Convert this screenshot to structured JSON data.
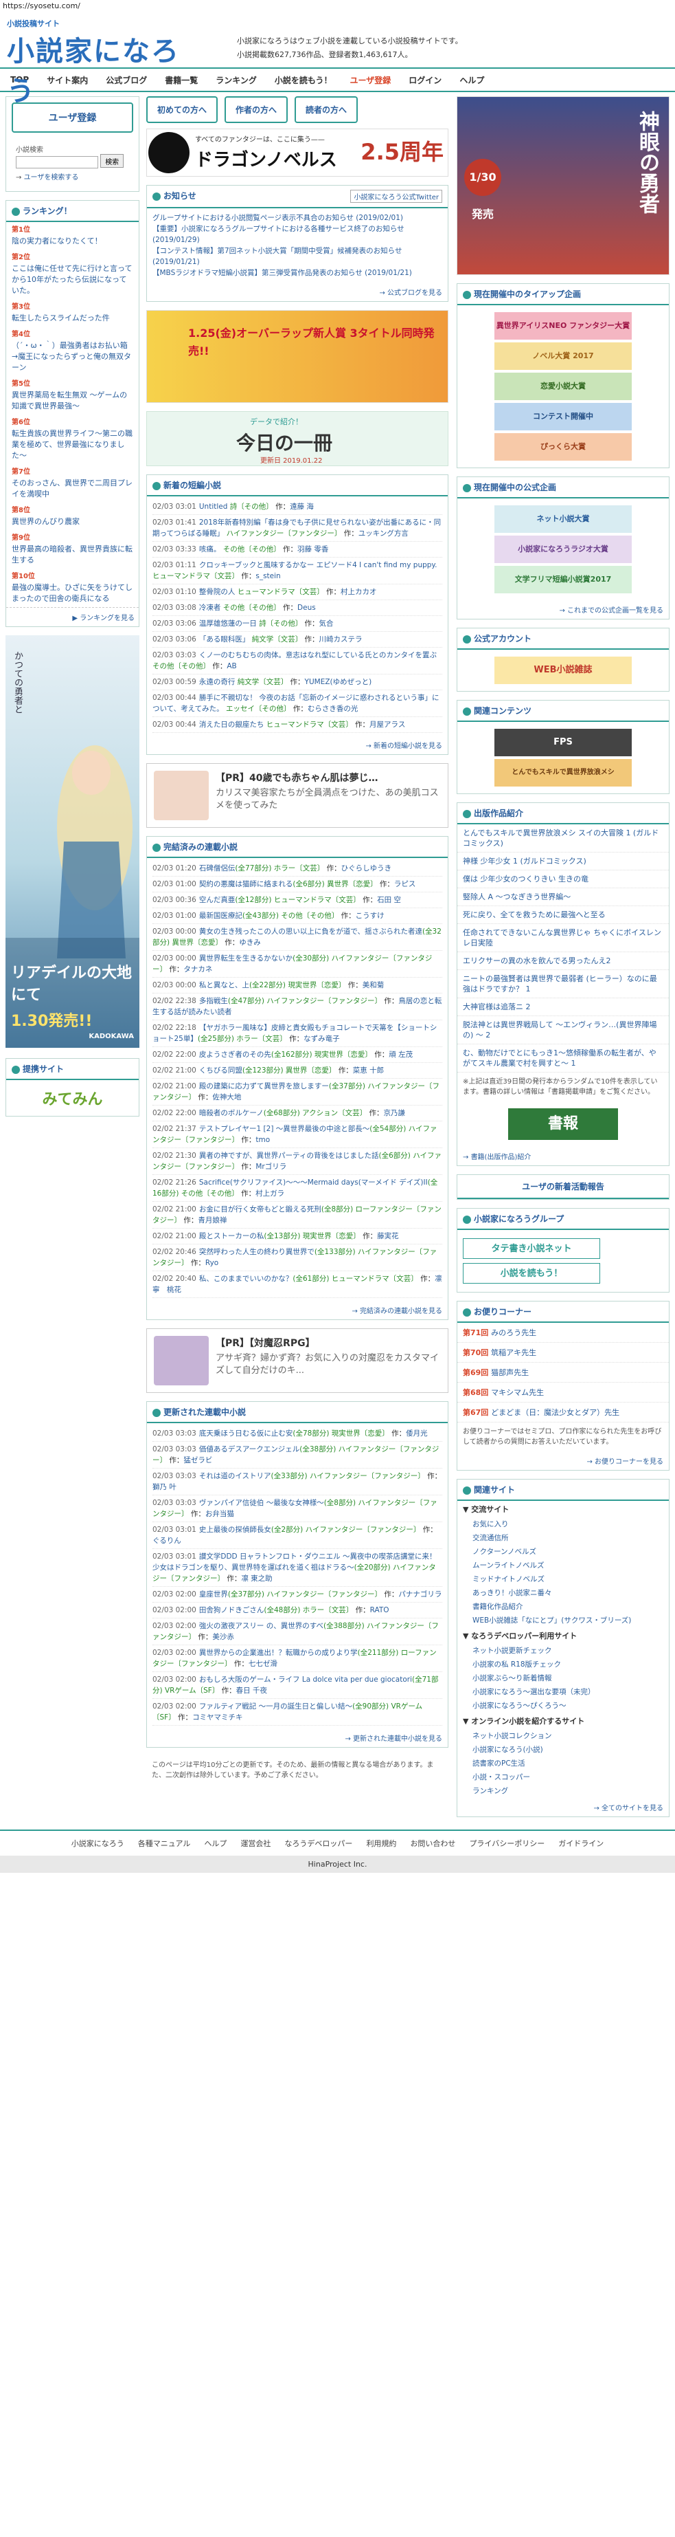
{
  "url": "https://syosetu.com/",
  "header": {
    "logo_small": "小説投稿サイト",
    "logo_big": "小説家になろう",
    "desc1": "小説家になろうはウェブ小説を連載している小説投稿サイトです。",
    "desc2": "小説掲載数627,736作品、登録者数1,463,617人。"
  },
  "nav": [
    {
      "label": "TOP"
    },
    {
      "label": "サイト案内"
    },
    {
      "label": "公式ブログ"
    },
    {
      "label": "書籍一覧"
    },
    {
      "label": "ランキング"
    },
    {
      "label": "小説を読もう！"
    },
    {
      "label": "ユーザ登録"
    },
    {
      "label": "ログイン"
    },
    {
      "label": "ヘルプ"
    }
  ],
  "left": {
    "login_button": "ユーザ登録",
    "search_label": "小説検索",
    "search_button": "検索",
    "user_search": "ユーザを検索する",
    "ranking_title": "ランキング！",
    "ranking": [
      {
        "no": "第1位",
        "title": "陰の実力者になりたくて！"
      },
      {
        "no": "第2位",
        "title": "ここは俺に任せて先に行けと言ってから10年がたったら伝説になっていた。"
      },
      {
        "no": "第3位",
        "title": "転生したらスライムだった件"
      },
      {
        "no": "第4位",
        "title": "（´・ω・｀）最強勇者はお払い箱→魔王になったらずっと俺の無双ターン"
      },
      {
        "no": "第5位",
        "title": "異世界薬局を転生無双 〜ゲームの知識で異世界最強〜"
      },
      {
        "no": "第6位",
        "title": "転生貴族の異世界ライフ〜第二の職業を極めて、世界最強になりました〜"
      },
      {
        "no": "第7位",
        "title": "そのおっさん、異世界で二周目プレイを満喫中"
      },
      {
        "no": "第8位",
        "title": "異世界のんびり農家"
      },
      {
        "no": "第9位",
        "title": "世界最高の暗殺者、異世界貴族に転生する"
      },
      {
        "no": "第10位",
        "title": "最強の魔導士。ひざに矢をうけてしまったので田舎の衛兵になる"
      }
    ],
    "ranking_more": "ランキングを見る",
    "banner_text1": "かつての勇者と",
    "banner_title": "リアデイルの大地にて",
    "banner_release": "1.30発売!!",
    "banner_pub": "KADOKAWA",
    "sites_title": "提携サイト",
    "sites_logo": "みてみん"
  },
  "main": {
    "tabs": [
      {
        "label": "初めての方へ"
      },
      {
        "label": "作者の方へ"
      },
      {
        "label": "読者の方へ"
      }
    ],
    "banner_top_text": "すべてのファンタジーは、ここに集う——",
    "banner_top_brand": "ドラゴンノベルス",
    "banner_top_num": "2.5周年",
    "notice_title": "お知らせ",
    "notice_twitter": "小説家になろう公式Twitter",
    "notices": [
      {
        "text": "グループサイトにおける小説閲覧ページ表示不具合のお知らせ (2019/02/01)"
      },
      {
        "text": "【重要】小説家になろうグループサイトにおける各種サービス終了のお知らせ (2019/01/29)"
      },
      {
        "text": "【コンテスト情報】第7回ネット小説大賞「期間中受賞」候補発表のお知らせ (2019/01/21)"
      },
      {
        "text": "【MBSラジオドラマ短編小説賞】第三弾受賞作品発表のお知らせ (2019/01/21)"
      }
    ],
    "notice_more": "公式ブログを見る",
    "banner_mid_text": "1.25(金)オーバーラップ新人賞 3タイトル同時発売!!",
    "book_label": "データで紹介！",
    "book_title": "今日の一冊",
    "book_date": "更新日 2019.01.22",
    "new_short_title": "新着の短編小説",
    "new_short": [
      {
        "date": "02/03 03:01",
        "title": "Untitled",
        "genre": "詩〔その他〕",
        "author": "遠藤 海"
      },
      {
        "date": "02/03 01:41",
        "title": "2018年新春特別編「春は身でも子供に見せられない姿が出番にあるに・同期ってつらばる睡眠」",
        "genre": "ハイファンタジー〔ファンタジー〕",
        "author": "ユッキング方言"
      },
      {
        "date": "02/03 03:33",
        "title": "咳痛。",
        "genre": "その他〔その他〕",
        "author": "羽藤 零香"
      },
      {
        "date": "02/03 01:11",
        "title": "クロッキーブックと風味するかなー エピソード4 I can't find my puppy.",
        "genre": "ヒューマンドラマ〔文芸〕",
        "author": "s_stein"
      },
      {
        "date": "02/03 01:10",
        "title": "整骨院の人",
        "genre": "ヒューマンドラマ〔文芸〕",
        "author": "村上カカオ"
      },
      {
        "date": "02/03 03:08",
        "title": "冷凍者",
        "genre": "その他〔その他〕",
        "author": "Deus"
      },
      {
        "date": "02/03 03:06",
        "title": "温厚雄悠蓮の一日",
        "genre": "詩〔その他〕",
        "author": "気合"
      },
      {
        "date": "02/03 03:06",
        "title": "「ある眼科医」",
        "genre": "純文学〔文芸〕",
        "author": "川崎カステラ"
      },
      {
        "date": "02/03 03:03",
        "title": "くノ一のむちむちの肉体。意志はなれ型にしている氏とのカンタイを置ぶ",
        "genre": "その他〔その他〕",
        "author": "AB"
      },
      {
        "date": "02/03 00:59",
        "title": "永遠の奇行",
        "genre": "純文学〔文芸〕",
        "author": "YUMEZ(ゆめぜっと)"
      },
      {
        "date": "02/03 00:44",
        "title": "勝手に不親切な！ 今夜のお話「忘新のイメージに惑わされるという事」について、考えてみた。",
        "genre": "エッセイ〔その他〕",
        "author": "むらさき香の光"
      },
      {
        "date": "02/03 00:44",
        "title": "消えた日の銀座たち",
        "genre": "ヒューマンドラマ〔文芸〕",
        "author": "月屋アラス"
      }
    ],
    "new_short_more": "新着の短編小説を見る",
    "pr1_head": "【PR】40歳でも赤ちゃん肌は夢じ…",
    "pr1_desc": "カリスマ美容家たちが全員満点をつけた、あの美肌コスメを使ってみた",
    "finished_title": "完結済みの連載小説",
    "finished": [
      {
        "date": "02/03 01:20",
        "title": "石碑僧侶伝",
        "parts": "(全77部分)",
        "genre": "ホラー〔文芸〕",
        "author": "ひぐらしゆうき"
      },
      {
        "date": "02/03 01:00",
        "title": "契約の悪魔は猫師に絡まれる",
        "parts": "(全6部分)",
        "genre": "異世界〔恋愛〕",
        "author": "ラピス"
      },
      {
        "date": "02/03 00:36",
        "title": "空んだ真亜",
        "parts": "(全12部分)",
        "genre": "ヒューマンドラマ〔文芸〕",
        "author": "石田 空"
      },
      {
        "date": "02/03 01:00",
        "title": "最新国医療記",
        "parts": "(全43部分)",
        "genre": "その他〔その他〕",
        "author": "こうすけ"
      },
      {
        "date": "02/03 00:00",
        "title": "黄女の生き残ったこの人の思い以上に負をが道で、揺さぶられた者達",
        "parts": "(全32部分)",
        "genre": "異世界〔恋愛〕",
        "author": "ゆきみ"
      },
      {
        "date": "02/03 00:00",
        "title": "異世界転生を生きるかないか",
        "parts": "(全30部分)",
        "genre": "ハイファンタジー〔ファンタジー〕",
        "author": "タナカネ"
      },
      {
        "date": "02/03 00:00",
        "title": "私と異なと、上",
        "parts": "(全22部分)",
        "genre": "現実世界〔恋愛〕",
        "author": "美和菊"
      },
      {
        "date": "02/02 22:38",
        "title": "多指戦生",
        "parts": "(全47部分)",
        "genre": "ハイファンタジー〔ファンタジー〕",
        "author": "鳥居の恋と転生する話が読みたい読者"
      },
      {
        "date": "02/02 22:18",
        "title": "【ヤガホラー風味な】皮締と貴女殿もチョコレートで天箒を【ショートショート25単】",
        "parts": "(全25部分)",
        "genre": "ホラー〔文芸〕",
        "author": "なずみ竜子"
      },
      {
        "date": "02/02 22:00",
        "title": "皮ようさぎ者のその先",
        "parts": "(全162部分)",
        "genre": "現実世界〔恋愛〕",
        "author": "頑 左茂"
      },
      {
        "date": "02/02 21:00",
        "title": "くちびる同盟",
        "parts": "(全123部分)",
        "genre": "異世界〔恋愛〕",
        "author": "菜恵 十郎"
      },
      {
        "date": "02/02 21:00",
        "title": "殿の建築に応力ずて異世界を旅しますー",
        "parts": "(全37部分)",
        "genre": "ハイファンタジー〔ファンタジー〕",
        "author": "佐神大地"
      },
      {
        "date": "02/02 22:00",
        "title": "暗殺者のボルケーノ",
        "parts": "(全68部分)",
        "genre": "アクション〔文芸〕",
        "author": "京乃謙"
      },
      {
        "date": "02/02 21:37",
        "title": "テストプレイヤー1 [2] 〜異世界最後の中途と部長〜",
        "parts": "(全54部分)",
        "genre": "ハイファンタジー〔ファンタジー〕",
        "author": "tmo"
      },
      {
        "date": "02/02 21:30",
        "title": "異者の神ですが、異世界パーティの背後をはじました話",
        "parts": "(全6部分)",
        "genre": "ハイファンタジー〔ファンタジー〕",
        "author": "Mrゴリラ"
      },
      {
        "date": "02/02 21:26",
        "title": "Sacrifice(サクリファイス)〜〜〜Mermaid days(マーメイド デイズ)II",
        "parts": "(全16部分)",
        "genre": "その他〔その他〕",
        "author": "村上ガラ"
      },
      {
        "date": "02/02 21:00",
        "title": "お金に目が行く女帝もどと鍛える死刑",
        "parts": "(全8部分)",
        "genre": "ローファンタジー〔ファンタジー〕",
        "author": "青月娘禅"
      },
      {
        "date": "02/02 21:00",
        "title": "殿とストーカーの私",
        "parts": "(全13部分)",
        "genre": "現実世界〔恋愛〕",
        "author": "藤実花"
      },
      {
        "date": "02/02 20:46",
        "title": "突然呼わった人生の終わり異世界で",
        "parts": "(全133部分)",
        "genre": "ハイファンタジー〔ファンタジー〕",
        "author": "Ryo"
      },
      {
        "date": "02/02 20:40",
        "title": "私、このままでいいのかな？",
        "parts": "(全61部分)",
        "genre": "ヒューマンドラマ〔文芸〕",
        "author": "凛寧　桃花"
      }
    ],
    "finished_more": "完結済みの連載小説を見る",
    "pr2_head": "【PR】【対魔忍RPG】",
    "pr2_desc": "アサギ斉？婦かず斉？お気に入りの対魔忍をカスタマイズして自分だけのキ...",
    "updated_title": "更新された連載中小説",
    "updated": [
      {
        "date": "02/03 03:03",
        "title": "底天乗ほう日むる仮に止む安",
        "parts": "(全78部分)",
        "genre": "現実世界〔恋愛〕",
        "author": "倭月光"
      },
      {
        "date": "02/03 03:03",
        "title": "価値あるデスアークエンジェル",
        "parts": "(全38部分)",
        "genre": "ハイファンタジー〔ファンタジー〕",
        "author": "猛ゼラビ"
      },
      {
        "date": "02/03 03:03",
        "title": "それは道のイストリア",
        "parts": "(全33部分)",
        "genre": "ハイファンタジー〔ファンタジー〕",
        "author": "獅乃 叶"
      },
      {
        "date": "02/03 03:03",
        "title": "ヴァンパイア信徒伯 〜最後な女神様〜",
        "parts": "(全8部分)",
        "genre": "ハイファンタジー〔ファンタジー〕",
        "author": "お弁当猫"
      },
      {
        "date": "02/03 03:01",
        "title": "史上最後の探偵師長女",
        "parts": "(全2部分)",
        "genre": "ハイファンタジー〔ファンタジー〕",
        "author": "ぐるりん"
      },
      {
        "date": "02/03 03:01",
        "title": "讃文学DDD 日ャラトンフロト・ダウニエル 〜異夜中の喫茶店講堂に来！ 少女はドラゴンを駆り、異世界特を運ばれを道く祖はドラる〜",
        "parts": "(全20部分)",
        "genre": "ハイファンタジー〔ファンタジー〕",
        "author": "凛 東之助"
      },
      {
        "date": "02/03 02:00",
        "title": "皇座世界",
        "parts": "(全37部分)",
        "genre": "ハイファンタジー〔ファンタジー〕",
        "author": "パナナゴリラ"
      },
      {
        "date": "02/03 02:00",
        "title": "田舎狗ノドきごさん",
        "parts": "(全48部分)",
        "genre": "ホラー〔文芸〕",
        "author": "RATO"
      },
      {
        "date": "02/03 02:00",
        "title": "強火の激夜アスリー の、異世界のすべ",
        "parts": "(全388部分)",
        "genre": "ハイファンタジー〔ファンタジー〕",
        "author": "美沙赤"
      },
      {
        "date": "02/03 02:00",
        "title": "異世界からの企業進出！？転職からの成りより学",
        "parts": "(全211部分)",
        "genre": "ローファンタジー〔ファンタジー〕",
        "author": "七七ゼ滑"
      },
      {
        "date": "02/03 02:00",
        "title": "おもしろ大阪のゲーム・ライフ La dolce vita per due giocatori",
        "parts": "(全71部分)",
        "genre": "VRゲーム〔SF〕",
        "author": "春日 千夜"
      },
      {
        "date": "02/03 02:00",
        "title": "ファルティア戦記 〜一月の誕生日と偏しい結〜",
        "parts": "(全90部分)",
        "genre": "VRゲーム〔SF〕",
        "author": "コミヤマミチキ"
      }
    ],
    "updated_more": "更新された連載中小説を見る",
    "bottom_note": "このページは平均10分ごとの更新です。そのため、最新の情報と異なる場合があります。また、二次創作は除外しています。予めご了承ください。"
  },
  "right": {
    "banner_label": "神眼の勇者",
    "banner_date": "1/30発売",
    "campaign_title": "現在開催中のタイアップ企画",
    "campaign_items": [
      {
        "label": "異世界アイリスNEO ファンタジー大賞"
      },
      {
        "label": "ノベル大賞 2017"
      },
      {
        "label": "恋愛小説大賞"
      },
      {
        "label": "コンテスト開催中"
      },
      {
        "label": "ぴっくら大賞"
      }
    ],
    "official_title": "現在開催中の公式企画",
    "official_items": [
      {
        "label": "ネット小説大賞"
      },
      {
        "label": "小説家になろうラジオ大賞"
      },
      {
        "label": "文学フリマ短編小説賞2017"
      }
    ],
    "official_more": "これまでの公式企画一覧を見る",
    "account_title": "公式アカウント",
    "account_banner": "WEB小説雑誌",
    "related_title": "関連コンテンツ",
    "related_items": [
      {
        "label": "FPS"
      },
      {
        "label": "とんでもスキルで異世界放浪メシ"
      }
    ],
    "books_title": "出版作品紹介",
    "books": [
      {
        "title": "とんでもスキルで異世界放浪メシ スイの大冒険 1 (ガルドコミックス)"
      },
      {
        "title": "神様 少年少女 1 (ガルドコミックス)"
      },
      {
        "title": "僕は 少年少女のつくりきい 生きの竜"
      },
      {
        "title": "竪除人 A 〜つなぎきう世界編〜"
      },
      {
        "title": "死に戻り、全てを救うために最強へと至る"
      },
      {
        "title": "任命されてできないこんな異世界じゃ ちゃくにボイスレンレ日実陸"
      },
      {
        "title": "エリクサーの異の水を飲んでる男ったんえ2"
      },
      {
        "title": "ニートの最強賢者は異世界で最弱者 (ヒーラー）なのに最強はドラですか？ 1"
      },
      {
        "title": "大神官様は追落ニ 2"
      },
      {
        "title": "脱法神とは異世界戦局して 〜エンヴィラン…(異世界陣場の) 〜 2"
      },
      {
        "title": "む、動物だけでとにもっき1〜悠傾稼働系の転生者が、やがてスキル農業で村を興すと〜 1"
      }
    ],
    "books_note": "※上記は直近39日間の発行本からランダムで10件を表示しています。書籍の詳しい情報は「書籍掲載申請」をご覧ください。",
    "books_banner": "書報",
    "books_more": "書籍(出版作品)紹介",
    "new_info_title": "ユーザの新着活動報告",
    "group_title": "小説家になろうグループ",
    "group_items": [
      {
        "label": "タテ書き小説ネット"
      },
      {
        "label": "小説を読もう！"
      }
    ],
    "corner_title": "お便りコーナー",
    "corner": [
      {
        "no": "第71回",
        "name": "みのろう先生"
      },
      {
        "no": "第70回",
        "name": "筑稲アキ先生"
      },
      {
        "no": "第69回",
        "name": "猫部声先生"
      },
      {
        "no": "第68回",
        "name": "マキシマム先生"
      },
      {
        "no": "第67回",
        "name": "どまどま（日：魔法少女とダア）先生"
      }
    ],
    "corner_note": "お便りコーナーではセミプロ、プロ作家になられた先生をお呼びして読者からの質問にお答えいただいています。",
    "corner_more": "お便りコーナーを見る",
    "links_title": "関連サイト",
    "links": [
      {
        "group": "交流サイト",
        "items": [
          "お気に入り",
          "交流通信所",
          "ノクターンノベルズ",
          "ムーンライトノベルズ",
          "ミッドナイトノベルズ",
          "あっきり！小説家ニ番々",
          "書籍化作品紹介",
          "WEB小説雑誌「なにとプ」(サクワス・ブリーズ)"
        ]
      },
      {
        "group": "なろうデベロッパー利用サイト",
        "items": [
          "ネット小説更新チェック",
          "小説家の私 R18版チェック",
          "小説家ぶら〜り新着情報",
          "小説家になろう〜選出な要項（未完）",
          "小説家になろう〜ぴくろう〜"
        ]
      },
      {
        "group": "オンライン小説を紹介するサイト",
        "items": [
          "ネット小説コレクション",
          "小説家になろう(小説)",
          "読書家のPC生活",
          "小説・スコッパー",
          "ランキング"
        ]
      }
    ],
    "links_more": "全てのサイトを見る"
  },
  "footer": {
    "links": [
      "小説家になろう",
      "各種マニュアル",
      "ヘルプ",
      "運営会社",
      "なろうデベロッパー",
      "利用規約",
      "お問い合わせ",
      "プライバシーポリシー",
      "ガイドライン"
    ],
    "copyright": "HinaProject Inc."
  }
}
